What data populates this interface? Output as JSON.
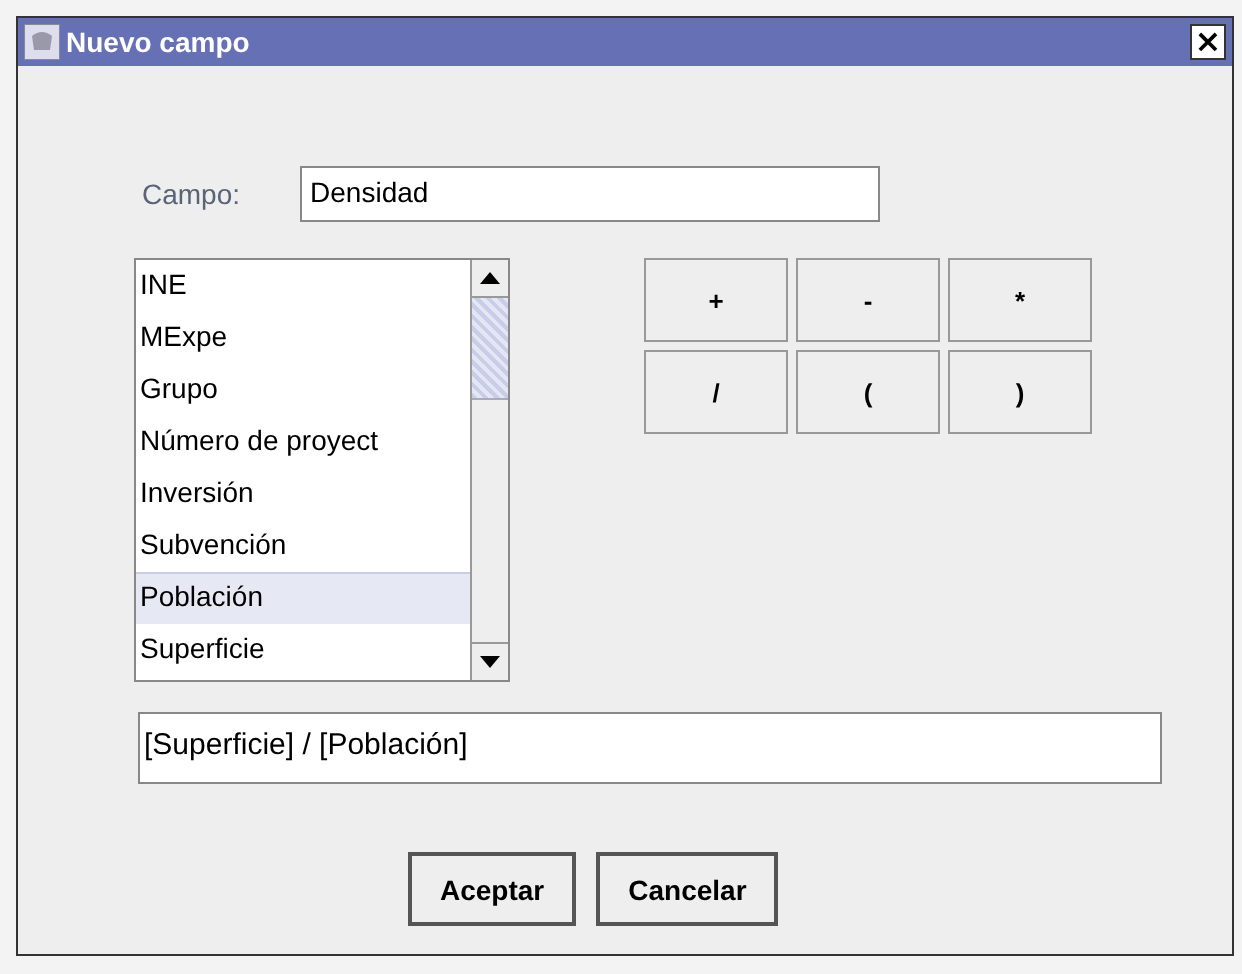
{
  "window": {
    "title": "Nuevo campo",
    "close": "×"
  },
  "field": {
    "label": "Campo:",
    "value": "Densidad"
  },
  "list": {
    "items": [
      {
        "label": "INE",
        "selected": false
      },
      {
        "label": "MExpe",
        "selected": false
      },
      {
        "label": "Grupo",
        "selected": false
      },
      {
        "label": "Número de proyect",
        "selected": false
      },
      {
        "label": "Inversión",
        "selected": false
      },
      {
        "label": "Subvención",
        "selected": false
      },
      {
        "label": "Población",
        "selected": true
      },
      {
        "label": "Superficie",
        "selected": false
      }
    ]
  },
  "operators": [
    "+",
    "-",
    "*",
    "/",
    "(",
    ")"
  ],
  "expression": {
    "value": "[Superficie] / [Población]"
  },
  "buttons": [
    "Aceptar",
    "Cancelar"
  ]
}
